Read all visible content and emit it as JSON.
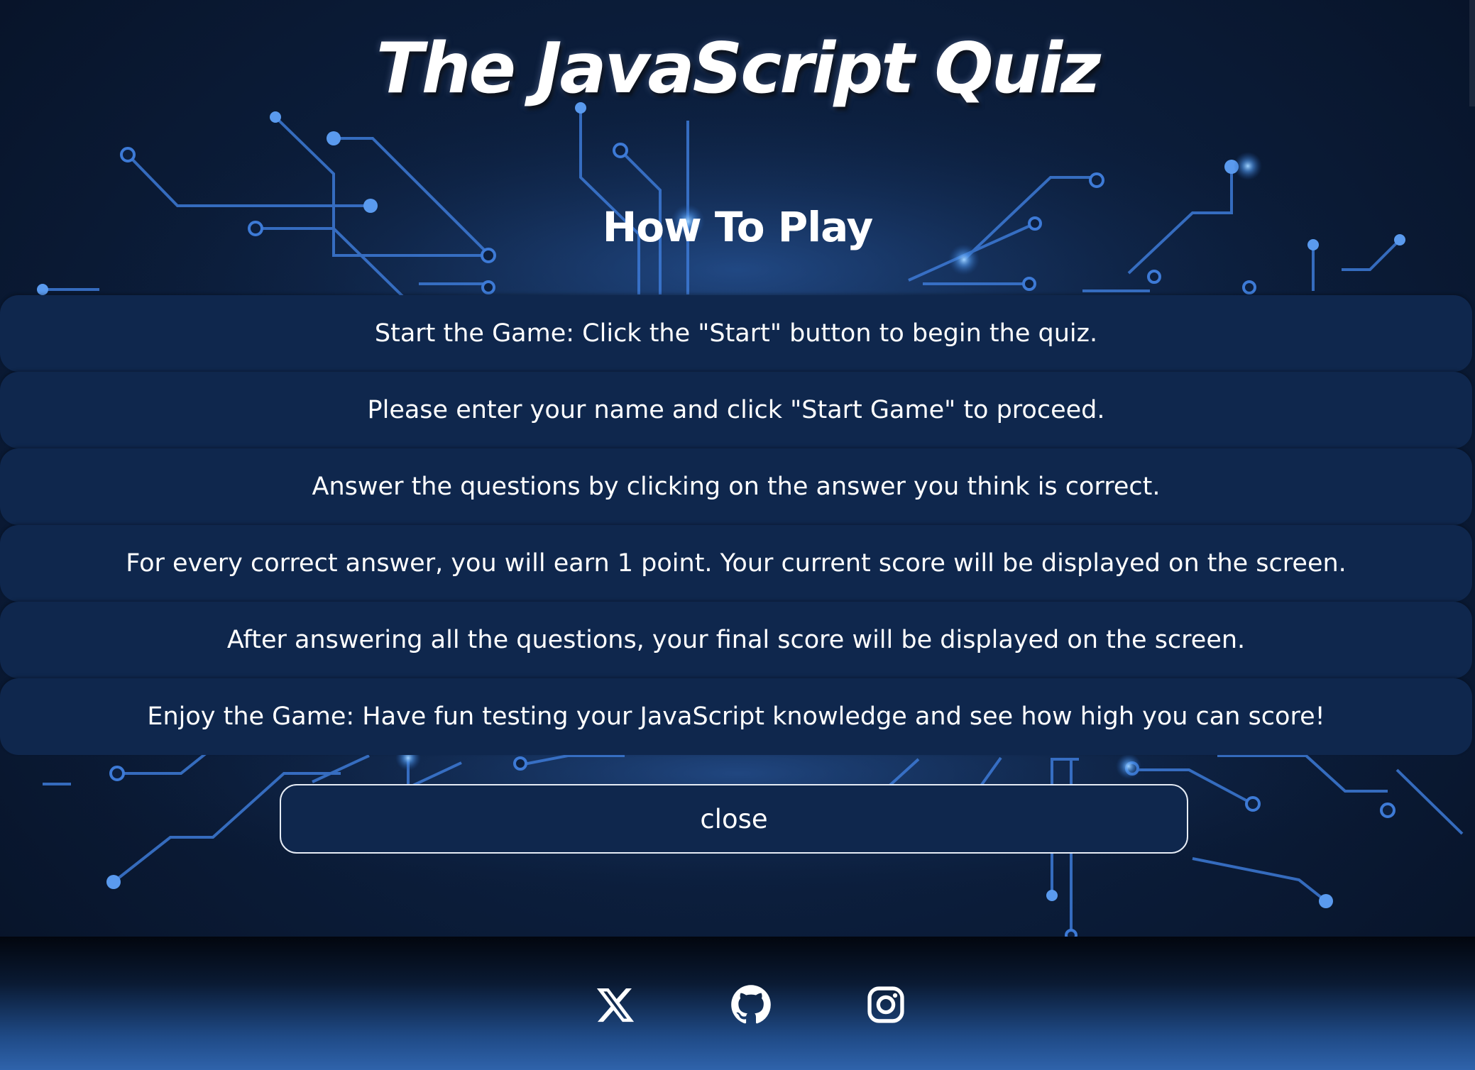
{
  "header": {
    "title": "The JavaScript Quiz"
  },
  "how_to_play": {
    "heading": "How To Play",
    "rules": [
      "Start the Game: Click the \"Start\" button to begin the quiz.",
      "Please enter your name and click \"Start Game\" to proceed.",
      "Answer the questions by clicking on the answer you think is correct.",
      "For every correct answer, you will earn 1 point. Your current score will be displayed on the screen.",
      "After answering all the questions, your final score will be displayed on the screen.",
      "Enjoy the Game: Have fun testing your JavaScript knowledge and see how high you can score!"
    ],
    "close_label": "close"
  },
  "footer": {
    "social_icons": [
      "x-icon",
      "github-icon",
      "instagram-icon"
    ]
  },
  "colors": {
    "panel": "#0f274d",
    "background": "#0c1f3e",
    "circuit": "#3d7ad6",
    "glow": "#7fc0ff",
    "footer_bottom": "#2f63ab",
    "text": "#ffffff"
  }
}
